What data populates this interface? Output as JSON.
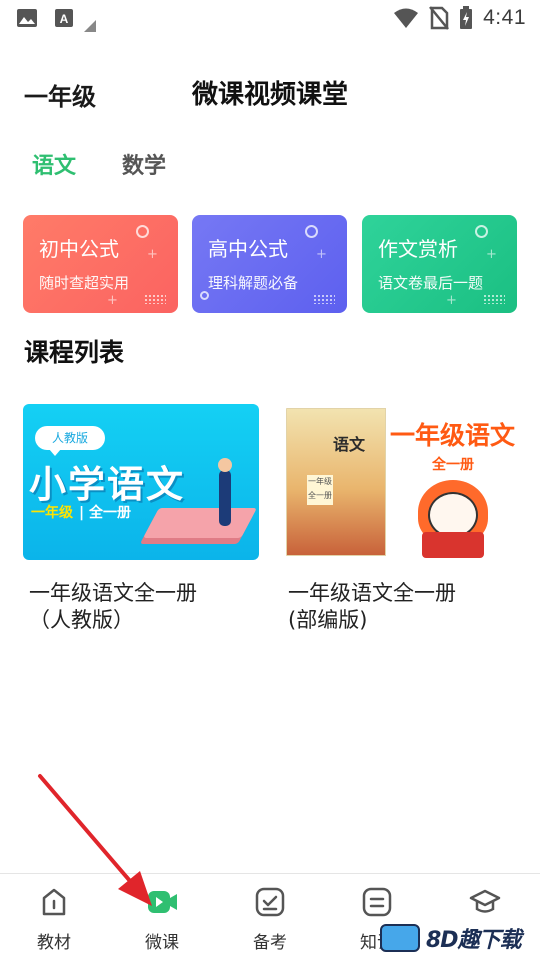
{
  "status_bar": {
    "time": "4:41"
  },
  "header": {
    "grade": "一年级",
    "title": "微课视频课堂"
  },
  "subject_tabs": [
    {
      "label": "语文",
      "active": true
    },
    {
      "label": "数学",
      "active": false
    }
  ],
  "feature_cards": [
    {
      "title": "初中公式",
      "subtitle": "随时查超实用",
      "color": "#fb6c63"
    },
    {
      "title": "高中公式",
      "subtitle": "理科解题必备",
      "color": "#6a6cf2"
    },
    {
      "title": "作文赏析",
      "subtitle": "语文卷最后一题",
      "color": "#24c98d"
    }
  ],
  "section_title": "课程列表",
  "courses": [
    {
      "title_line1": "一年级语文全一册",
      "title_line2": "（人教版）",
      "cover": {
        "badge": "人教版",
        "big": "小学语文",
        "grade": "一年级",
        "volume": "| 全一册"
      }
    },
    {
      "title_line1": "一年级语文全一册",
      "title_line2": "(部编版)",
      "cover": {
        "book_title": "语文",
        "book_label": "一年级 全一册",
        "big": "一年级语文",
        "volume": "全一册"
      }
    }
  ],
  "bottom_nav": [
    {
      "label": "教材",
      "icon": "textbook-icon",
      "active": false
    },
    {
      "label": "微课",
      "icon": "video-camera-icon",
      "active": true
    },
    {
      "label": "备考",
      "icon": "checklist-icon",
      "active": false
    },
    {
      "label": "知识",
      "icon": "document-icon",
      "active": false
    },
    {
      "label": "",
      "icon": "graduation-cap-icon",
      "active": false
    }
  ],
  "watermark": {
    "text": "8D趣下载"
  },
  "colors": {
    "accent": "#2fbf71",
    "annotation_arrow": "#e0252b"
  }
}
